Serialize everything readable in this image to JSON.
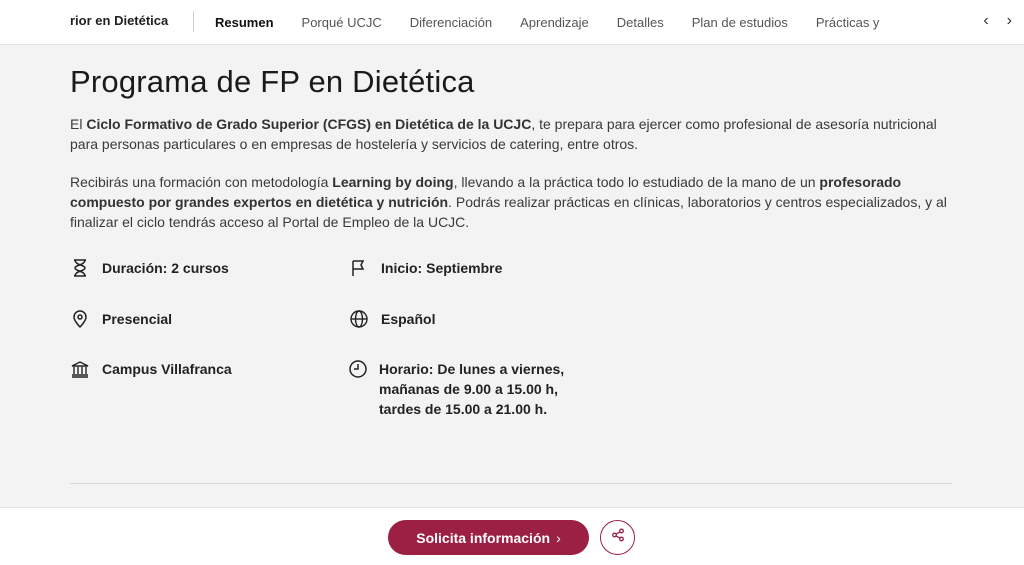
{
  "nav": {
    "course_label": "rior en Dietética",
    "tabs": [
      "Resumen",
      "Porqué UCJC",
      "Diferenciación",
      "Aprendizaje",
      "Detalles",
      "Plan de estudios",
      "Prácticas y"
    ],
    "active_tab": "Resumen",
    "prev_arrow": "‹",
    "next_arrow": "›"
  },
  "main": {
    "title": "Programa de FP en Dietética",
    "para1": {
      "t1": "El ",
      "b1": "Ciclo Formativo de Grado Superior (CFGS) en Dietética de la UCJC",
      "t2": ", te prepara para ejercer como profesional de asesoría nutricional para personas particulares o en empresas de hostelería y servicios de catering, entre otros."
    },
    "para2": {
      "t1": "Recibirás una formación con metodología ",
      "b1": "Learning by doing",
      "t2": ", llevando a la práctica todo lo estudiado de la mano de un ",
      "b2": "profesorado compuesto por grandes expertos en dietética y nutrición",
      "t3": ". Podrás realizar prácticas en clínicas, laboratorios y centros especializados, y al finalizar el ciclo tendrás acceso al Portal de Empleo de la UCJC."
    }
  },
  "facts": {
    "duration": "Duración: 2 cursos",
    "start": "Inicio: Septiembre",
    "modality": "Presencial",
    "language": "Español",
    "campus": "Campus Villafranca",
    "schedule": "Horario: De lunes a viernes, mañanas de 9.00 a 15.00 h, tardes de 15.00 a 21.00 h."
  },
  "icons": {
    "duration": "hourglass-icon",
    "start": "flag-icon",
    "modality": "location-pin-icon",
    "language": "globe-icon",
    "campus": "building-icon",
    "schedule": "clock-icon",
    "share": "share-icon"
  },
  "footer": {
    "cta_label": "Solicita información",
    "cta_chevron": "›"
  },
  "colors": {
    "brand": "#9b2044"
  }
}
